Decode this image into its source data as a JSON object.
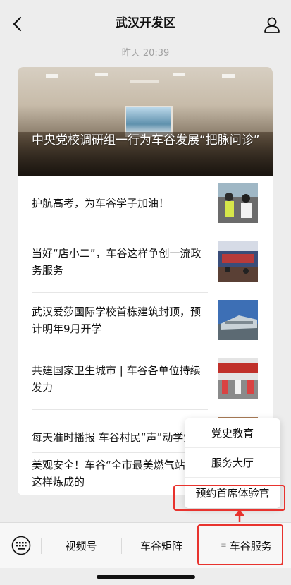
{
  "nav": {
    "title": "武汉开发区",
    "back_icon": "chevron-left-icon",
    "profile_icon": "user-icon"
  },
  "timestamp": "昨天 20:39",
  "article": {
    "hero_title": "中央党校调研组一行为车谷发展“把脉问诊”",
    "items": [
      {
        "title": "护航高考，为车谷学子加油！"
      },
      {
        "title": "当好“店小二”，车谷这样争创一流政务服务"
      },
      {
        "title": "武汉爱莎国际学校首栋建筑封顶，预计明年9月开学"
      },
      {
        "title": "共建国家卫生城市 | 车谷各单位持续发力"
      },
      {
        "title": "每天准时播报 车谷村民“声”动学党史"
      },
      {
        "title": "美观安全！车谷“全市最美燃气站”是这样炼成的"
      }
    ]
  },
  "popup_menu": {
    "items": [
      "党史教育",
      "服务大厅",
      "预约首席体验官"
    ]
  },
  "bottom_menu": {
    "keyboard_icon": "keyboard-icon",
    "items": [
      "视频号",
      "车谷矩阵",
      "车谷服务"
    ],
    "menu_glyph": "≡"
  },
  "colors": {
    "highlight": "#e8332e",
    "background": "#ededed"
  }
}
